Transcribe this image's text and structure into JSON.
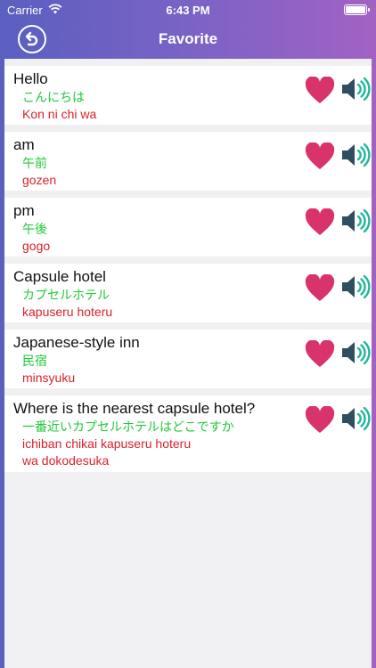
{
  "status": {
    "carrier": "Carrier",
    "time": "6:43 PM"
  },
  "nav": {
    "title": "Favorite"
  },
  "colors": {
    "heart": "#d8336b",
    "speaker_body": "#2f4f5f",
    "speaker_waves": "#1fb79a",
    "japanese_text": "#21c93a",
    "romaji_text": "#d8222b"
  },
  "items": [
    {
      "english": "Hello",
      "japanese": "こんにちは",
      "romaji": [
        "Kon ni chi wa"
      ]
    },
    {
      "english": "am",
      "japanese": "午前",
      "romaji": [
        "gozen"
      ]
    },
    {
      "english": "pm",
      "japanese": "午後",
      "romaji": [
        "gogo"
      ]
    },
    {
      "english": "Capsule hotel",
      "japanese": "カプセルホテル",
      "romaji": [
        "kapuseru hoteru"
      ]
    },
    {
      "english": "Japanese-style inn",
      "japanese": "民宿",
      "romaji": [
        "minsyuku"
      ]
    },
    {
      "english": "Where is the nearest capsule hotel?",
      "japanese": "一番近いカプセルホテルはどこですか",
      "romaji": [
        "ichiban chikai kapuseru hoteru",
        "wa dokodesuka"
      ]
    }
  ]
}
